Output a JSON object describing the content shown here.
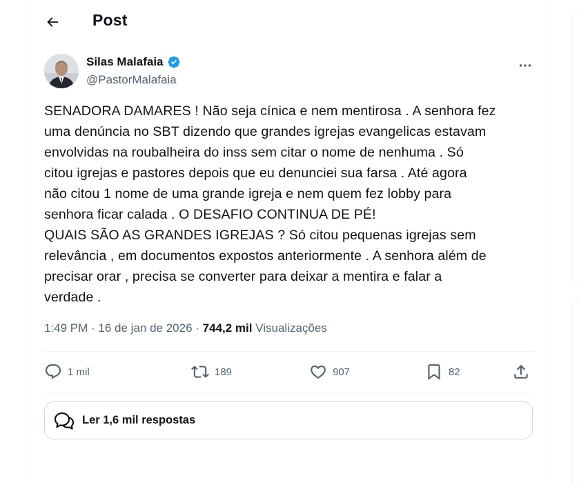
{
  "header": {
    "title": "Post"
  },
  "author": {
    "display_name": "Silas Malafaia",
    "handle": "@PastorMalafaia"
  },
  "tweet": {
    "text": "SENADORA DAMARES ! Não seja cínica e nem mentirosa . A senhora fez\numa denúncia no SBT dizendo que grandes igrejas evangelicas estavam\nenvolvidas na roubalheira do inss sem citar o nome de nenhuma . Só\ncitou igrejas e pastores depois que eu denunciei sua farsa . Até agora\nnão citou 1 nome de uma grande igreja e nem quem fez lobby para\nsenhora ficar calada . O DESAFIO CONTINUA DE PÉ!\nQUAIS SÃO AS GRANDES IGREJAS ? Só citou pequenas igrejas sem\nrelevância , em documentos expostos anteriormente . A senhora além de\nprecisar orar , precisa se converter para deixar a mentira e falar a\nverdade .",
    "time": "1:49 PM",
    "separator": " · ",
    "date": "16 de jan de 2026",
    "views_count": "744,2 mil",
    "views_label": "Visualizações"
  },
  "actions": {
    "reply_count": "1 mil",
    "retweet_count": "189",
    "like_count": "907",
    "bookmark_count": "82"
  },
  "replies_button": {
    "label": "Ler 1,6 mil respostas"
  },
  "colors": {
    "accent": "#1d9bf0",
    "text": "#0f1419",
    "secondary": "#536471",
    "border": "#eff3f4"
  },
  "icons": [
    "back-arrow-icon",
    "verified-badge-icon",
    "more-icon",
    "reply-icon",
    "retweet-icon",
    "like-icon",
    "bookmark-icon",
    "share-icon",
    "replies-bubble-icon"
  ]
}
